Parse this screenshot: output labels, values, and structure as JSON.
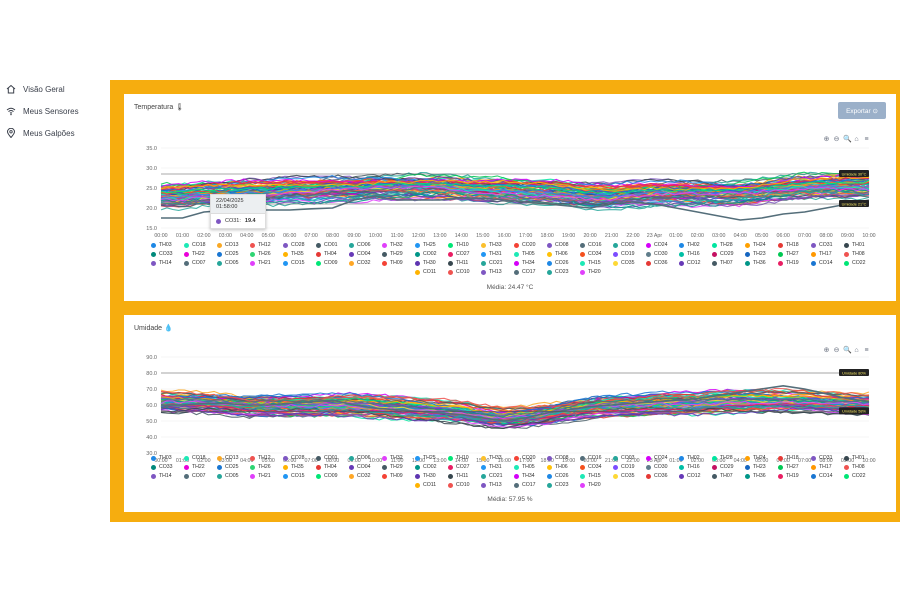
{
  "sidebar": {
    "items": [
      {
        "label": "Visão Geral",
        "icon": "home-icon"
      },
      {
        "label": "Meus Sensores",
        "icon": "wifi-icon"
      },
      {
        "label": "Meus Galpões",
        "icon": "map-pin-icon"
      }
    ]
  },
  "export_label": "Exportar",
  "colors": {
    "frame": "#f6ad0f",
    "button": "#9bb0c9"
  },
  "sensors": [
    {
      "id": "TH03",
      "color": "#1e88e5"
    },
    {
      "id": "CO18",
      "color": "#1de9b6"
    },
    {
      "id": "CO13",
      "color": "#f9a825"
    },
    {
      "id": "TH12",
      "color": "#ef5350"
    },
    {
      "id": "CO28",
      "color": "#7e57c2"
    },
    {
      "id": "CO01",
      "color": "#455a64"
    },
    {
      "id": "CO06",
      "color": "#26a69a"
    },
    {
      "id": "TH32",
      "color": "#e040fb"
    },
    {
      "id": "TH25",
      "color": "#2196f3"
    },
    {
      "id": "TH10",
      "color": "#00e676"
    },
    {
      "id": "TH33",
      "color": "#fbc02d"
    },
    {
      "id": "CO20",
      "color": "#f44336"
    },
    {
      "id": "CO08",
      "color": "#7e57c2"
    },
    {
      "id": "CO16",
      "color": "#546e7a"
    },
    {
      "id": "CO03",
      "color": "#26a69a"
    },
    {
      "id": "CO24",
      "color": "#d500f9"
    },
    {
      "id": "TH02",
      "color": "#1e88e5"
    },
    {
      "id": "TH28",
      "color": "#00e5a0"
    },
    {
      "id": "TH24",
      "color": "#ffa000"
    },
    {
      "id": "TH18",
      "color": "#e53935"
    },
    {
      "id": "CO31",
      "color": "#7e57c2"
    },
    {
      "id": "TH01",
      "color": "#37474f"
    },
    {
      "id": "CO33",
      "color": "#00897b"
    },
    {
      "id": "TH22",
      "color": "#ea00d9"
    },
    {
      "id": "CO25",
      "color": "#1976d2"
    },
    {
      "id": "TH26",
      "color": "#2ed573"
    },
    {
      "id": "TH35",
      "color": "#ffb300"
    },
    {
      "id": "TH04",
      "color": "#e53935"
    },
    {
      "id": "CO04",
      "color": "#673ab7"
    },
    {
      "id": "TH29",
      "color": "#455a64"
    },
    {
      "id": "CO02",
      "color": "#009688"
    },
    {
      "id": "CO27",
      "color": "#e91e63"
    },
    {
      "id": "TH31",
      "color": "#2196f3"
    },
    {
      "id": "TH05",
      "color": "#1de9b6"
    },
    {
      "id": "TH06",
      "color": "#ffc107"
    },
    {
      "id": "CO34",
      "color": "#f4511e"
    },
    {
      "id": "CO19",
      "color": "#7c4dff"
    },
    {
      "id": "CO30",
      "color": "#607d8b"
    },
    {
      "id": "TH16",
      "color": "#00bfa5"
    },
    {
      "id": "CO29",
      "color": "#c51162"
    },
    {
      "id": "TH23",
      "color": "#1565c0"
    },
    {
      "id": "TH27",
      "color": "#00c853"
    },
    {
      "id": "TH17",
      "color": "#ff9800"
    },
    {
      "id": "TH08",
      "color": "#ef5350"
    },
    {
      "id": "TH14",
      "color": "#7e57c2"
    },
    {
      "id": "CO07",
      "color": "#546e7a"
    },
    {
      "id": "CO05",
      "color": "#26a69a"
    },
    {
      "id": "TH21",
      "color": "#e040fb"
    },
    {
      "id": "CO15",
      "color": "#2196f3"
    },
    {
      "id": "CO09",
      "color": "#00e676"
    },
    {
      "id": "CO32",
      "color": "#ffa726"
    },
    {
      "id": "TH09",
      "color": "#f44336"
    },
    {
      "id": "TH30",
      "color": "#5e35b1"
    },
    {
      "id": "TH11",
      "color": "#37474f"
    },
    {
      "id": "CO21",
      "color": "#26a69a"
    },
    {
      "id": "TH34",
      "color": "#d500f9"
    },
    {
      "id": "CO26",
      "color": "#1e88e5"
    },
    {
      "id": "TH15",
      "color": "#1de9b6"
    },
    {
      "id": "CO35",
      "color": "#fdd835"
    },
    {
      "id": "CO36",
      "color": "#e53935"
    },
    {
      "id": "CO12",
      "color": "#673ab7"
    },
    {
      "id": "TH07",
      "color": "#455a64"
    },
    {
      "id": "TH36",
      "color": "#009688"
    },
    {
      "id": "TH19",
      "color": "#e91e63"
    },
    {
      "id": "CO14",
      "color": "#1976d2"
    },
    {
      "id": "CO22",
      "color": "#00e676"
    },
    {
      "id": "CO11",
      "color": "#ffb300"
    },
    {
      "id": "CO10",
      "color": "#ef5350"
    },
    {
      "id": "TH13",
      "color": "#7e57c2"
    },
    {
      "id": "CO17",
      "color": "#546e7a"
    },
    {
      "id": "CO23",
      "color": "#26a69a"
    },
    {
      "id": "TH20",
      "color": "#e040fb"
    }
  ],
  "chart_data": [
    {
      "type": "line",
      "title": "Temperatura 🌡",
      "x": [
        "00:00",
        "01:00",
        "02:00",
        "03:00",
        "04:00",
        "05:00",
        "06:00",
        "07:00",
        "08:00",
        "09:00",
        "10:00",
        "11:00",
        "12:00",
        "13:00",
        "14:00",
        "15:00",
        "16:00",
        "17:00",
        "18:00",
        "19:00",
        "20:00",
        "21:00",
        "22:00",
        "23 Apr",
        "01:00",
        "02:00",
        "03:00",
        "04:00",
        "05:00",
        "06:00",
        "07:00",
        "08:00",
        "09:00",
        "10:00"
      ],
      "y_ticks": [
        "35.0",
        "30.0",
        "25.0",
        "20.0",
        "15.0"
      ],
      "ylim": [
        15,
        35
      ],
      "series_count": 72,
      "band_center": [
        23,
        23,
        23.5,
        23.5,
        24,
        24,
        24.5,
        24.5,
        25,
        25,
        25.5,
        25.5,
        25.5,
        25.5,
        25,
        24.5,
        24.5,
        24,
        24,
        23.5,
        23,
        23,
        23.5,
        24,
        24,
        24,
        24,
        24,
        24.5,
        25,
        25.5,
        25.5,
        25.5,
        25.5
      ],
      "band_spread": 3.2,
      "highlight": {
        "name": "CO31",
        "color": "#546e7a",
        "values": [
          17.5,
          17.5,
          19,
          19.4,
          19.5,
          19.5,
          19.5,
          19.8,
          20,
          22,
          23,
          22,
          22,
          22,
          22.5,
          22.5,
          22,
          21.5,
          21,
          20.5,
          20,
          21,
          21.5,
          21,
          20,
          19,
          18,
          17,
          17.5,
          18.5,
          19,
          20,
          21,
          22
        ]
      },
      "threshold_upper": {
        "label": "Umidade 30°C",
        "value": 28.5
      },
      "threshold_lower": {
        "label": "Umidade 21°C",
        "value": 21
      },
      "tooltip": {
        "time": "22/04/2025 01:58:00",
        "series": "CO31:",
        "value": "19.4"
      },
      "average": "Média: 24.47 °C"
    },
    {
      "type": "line",
      "title": "Umidade 💧",
      "x": [
        "00:00",
        "01:00",
        "02:00",
        "03:00",
        "04:00",
        "05:00",
        "06:00",
        "07:00",
        "08:00",
        "09:00",
        "10:00",
        "11:00",
        "12:00",
        "13:00",
        "14:00",
        "15:00",
        "16:00",
        "17:00",
        "18:00",
        "19:00",
        "20:00",
        "21:00",
        "22:00",
        "23 Apr",
        "01:00",
        "02:00",
        "03:00",
        "04:00",
        "05:00",
        "06:00",
        "07:00",
        "08:00",
        "09:00",
        "10:00"
      ],
      "y_ticks": [
        "90.0",
        "80.0",
        "70.0",
        "60.0",
        "50.0",
        "40.0",
        "30.0"
      ],
      "ylim": [
        30,
        90
      ],
      "series_count": 72,
      "band_center": [
        62,
        62,
        62,
        61,
        60,
        60,
        60,
        60,
        60,
        60,
        59,
        58,
        57,
        56,
        55,
        53,
        52,
        53,
        55,
        57,
        59,
        60,
        60,
        61,
        61,
        61,
        62,
        62,
        62,
        62,
        62,
        61,
        61,
        61
      ],
      "band_spread": 7,
      "highlight": {
        "name": "CO01",
        "color": "#546e7a",
        "values": [
          60,
          60,
          61,
          61,
          60,
          60,
          61,
          62,
          63,
          60,
          58,
          57,
          56,
          55,
          54,
          52,
          50,
          52,
          55,
          57,
          59,
          60,
          61,
          62,
          63,
          64,
          66,
          68,
          70,
          72,
          70,
          67,
          64,
          62
        ]
      },
      "threshold_upper": {
        "label": "Umidade 80%",
        "value": 80
      },
      "threshold_lower": {
        "label": "Umidade 58%",
        "value": 56
      },
      "average": "Média: 57.95 %"
    }
  ]
}
